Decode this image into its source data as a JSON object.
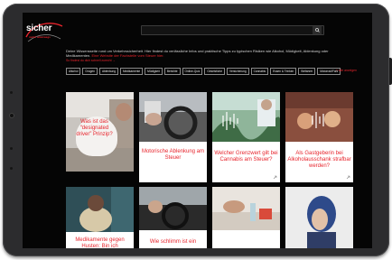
{
  "site": {
    "logo_main": "sicher",
    "logo_sub": "mobil unterwegs"
  },
  "search": {
    "placeholder": "",
    "button_icon": "search-icon"
  },
  "intro": {
    "text": "Deine Wissensseite rund um Verkehrssicherheit. Hier findest du verlässliche Infos und praktische Tipps zu typischen Risiken wie Alkohol, Müdigkeit, Ablenkung oder Medikamenten.",
    "link": "Eine Website der Fachstelle vom Steuer hier.",
    "tagline": "So findest du dich schnell zurecht →"
  },
  "tags": [
    "Alkohol",
    "Drogen",
    "Ablenkung",
    "Medikamente",
    "Müdigkeit",
    "Berichte",
    "Online-Quiz",
    "Gesetzliche",
    "Versicherung",
    "Cannabis",
    "Essen & Trinken",
    "Beifahrer",
    "Motorrad/Fahr"
  ],
  "more_link": "+ alle anzeigen",
  "cards": [
    {
      "title": "Was ist das “designated driver” Prinzip?"
    },
    {
      "title": "Motorische Ablenkung am Steuer"
    },
    {
      "title": "Welcher Grenzwert gilt bei Cannabis am Steuer?"
    },
    {
      "title": "Als Gastgeberin bei Alkoholausschank strafbar werden?"
    },
    {
      "title": "Medikamente gegen Husten: Bin ich"
    },
    {
      "title": "Wie schlimm ist ein"
    },
    {
      "title": ""
    },
    {
      "title": ""
    }
  ],
  "colors": {
    "accent": "#e7242c",
    "background": "#050505",
    "bezel": "#2c2c2e"
  }
}
